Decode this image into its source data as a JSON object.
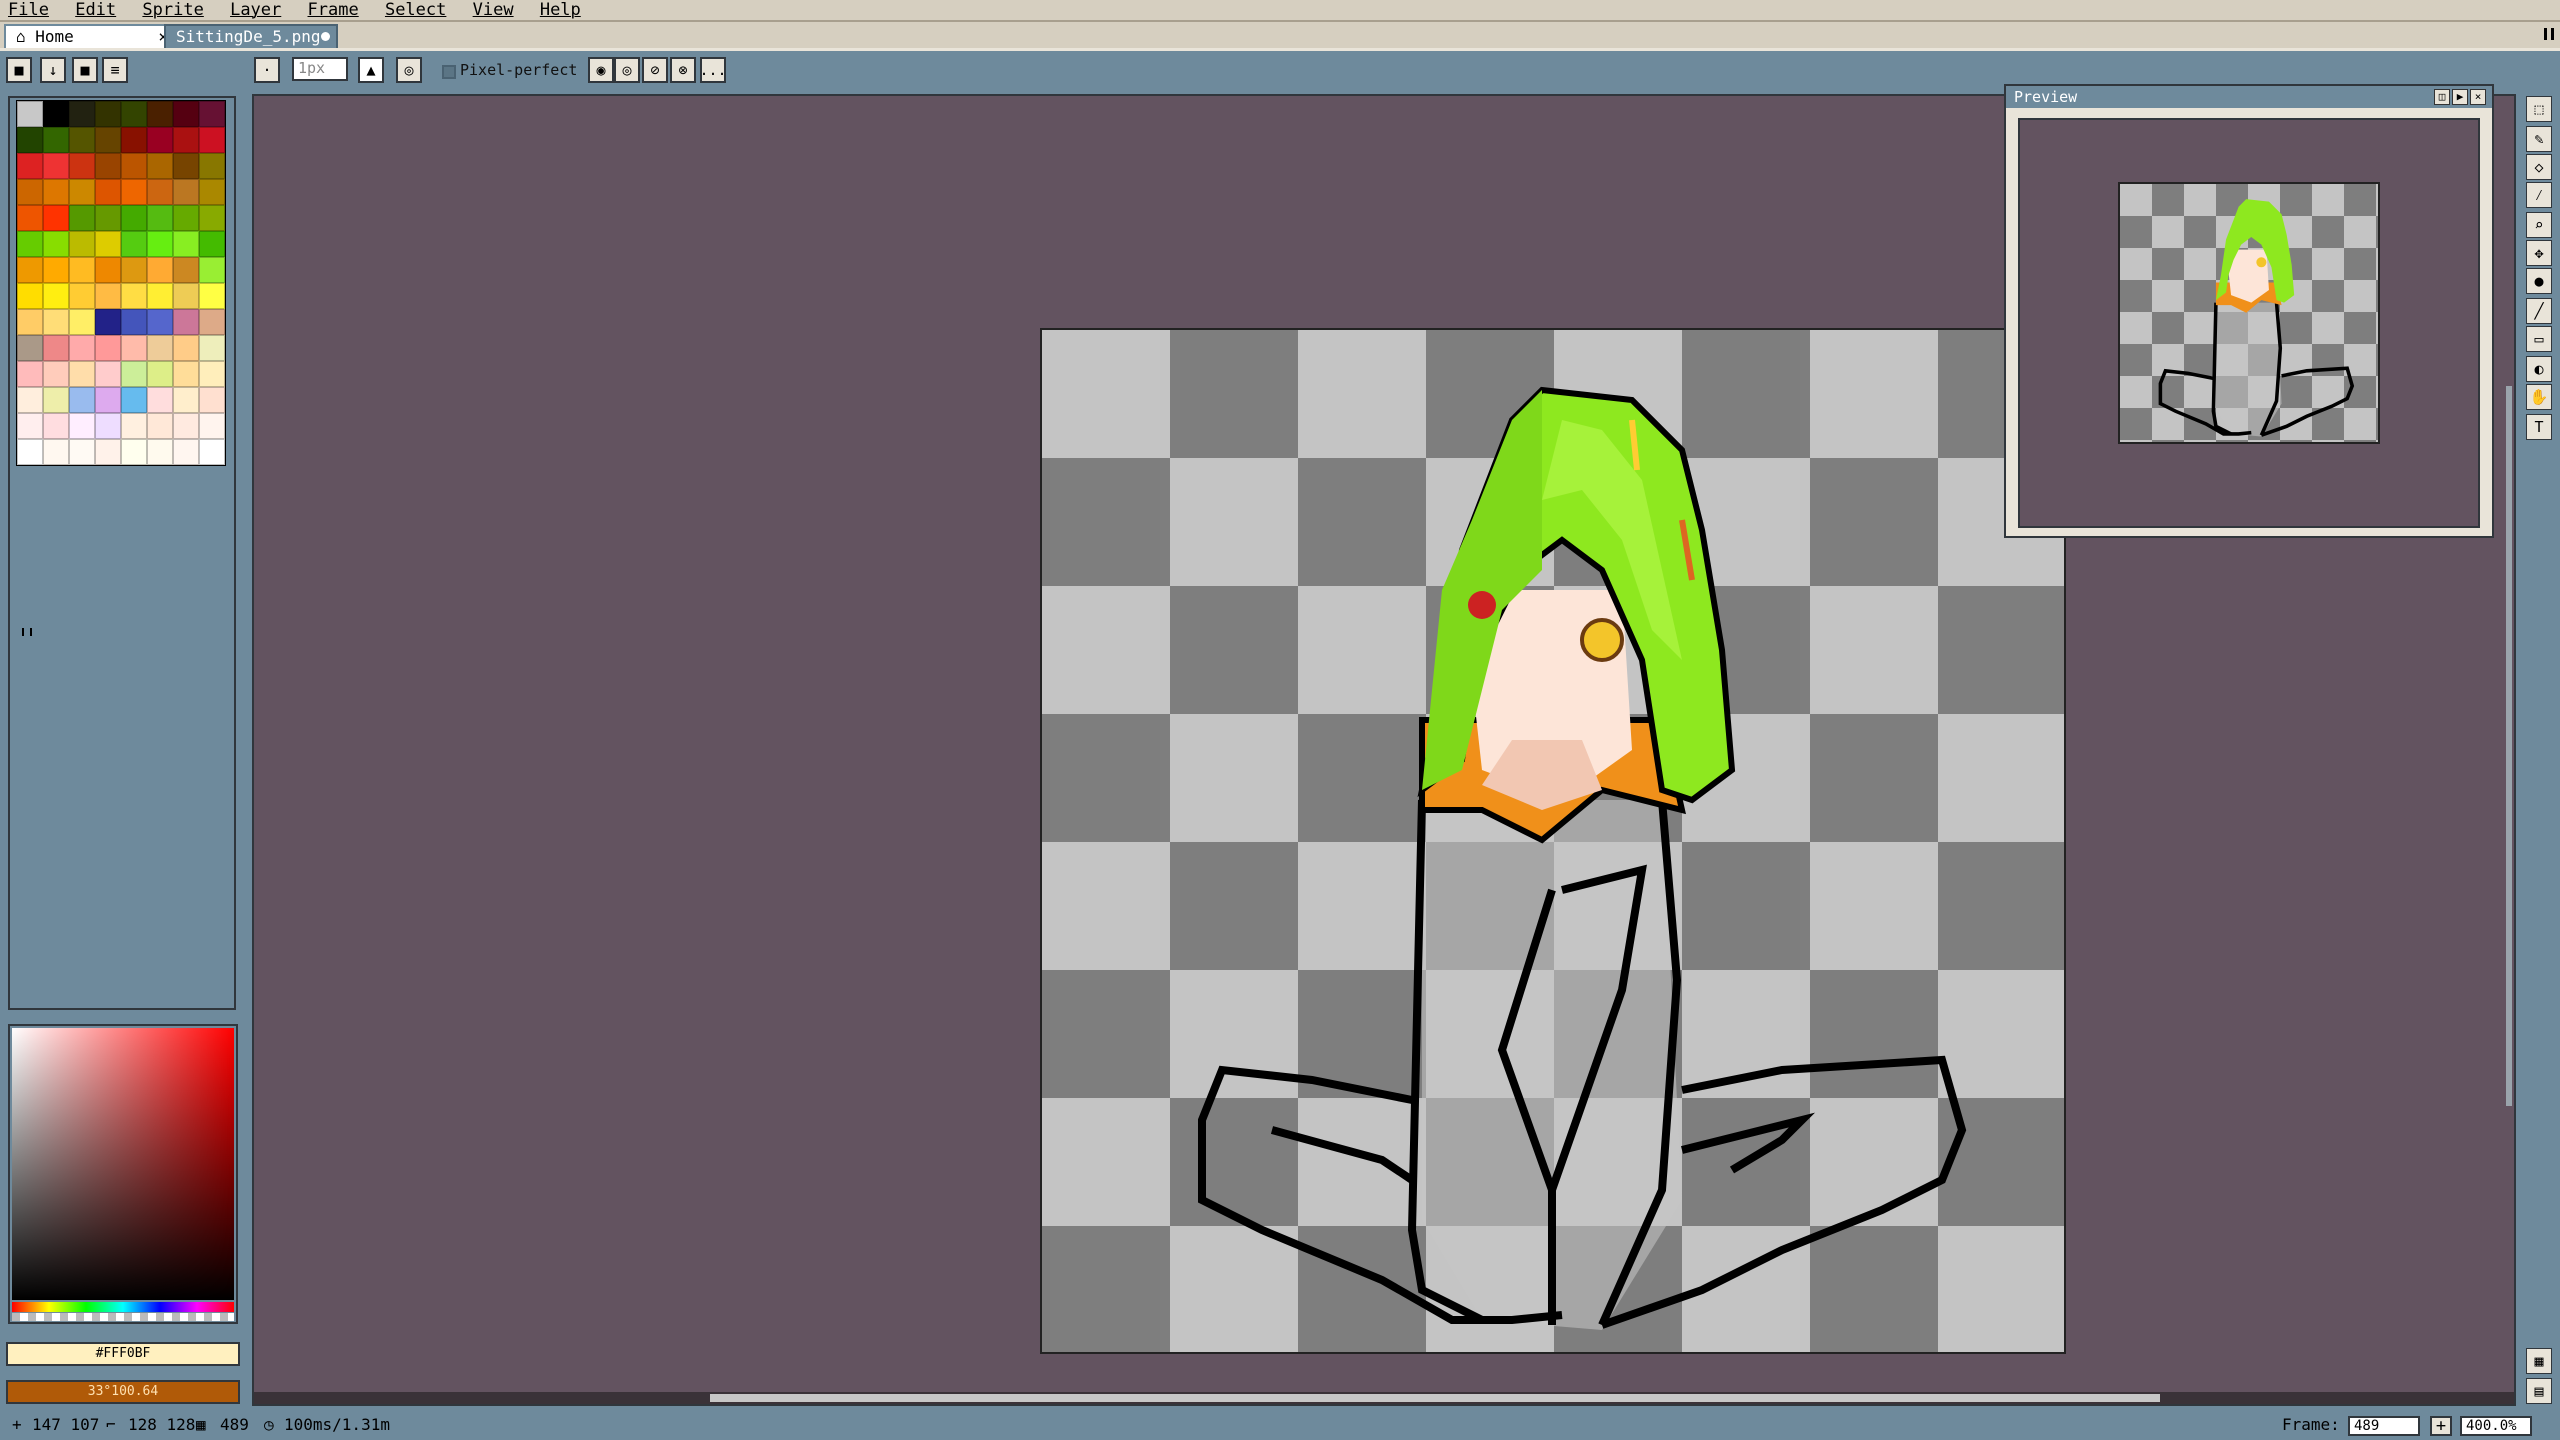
{
  "menu": [
    "File",
    "Edit",
    "Sprite",
    "Layer",
    "Frame",
    "Select",
    "View",
    "Help"
  ],
  "tabs": [
    {
      "label": "Home",
      "close": "×"
    },
    {
      "label": "SittingDe_5.png"
    }
  ],
  "toolbar": {
    "brush_size": "1px",
    "pixel_perfect_label": "Pixel-perfect",
    "more": "..."
  },
  "palette_colors": [
    "#c8c8c8",
    "#000000",
    "#222211",
    "#333300",
    "#334400",
    "#4a2000",
    "#550011",
    "#661133",
    "#224400",
    "#336600",
    "#555500",
    "#664400",
    "#881100",
    "#990022",
    "#aa1111",
    "#cc1122",
    "#dd2222",
    "#ee3333",
    "#cc3311",
    "#994400",
    "#bb5500",
    "#aa6600",
    "#774400",
    "#887700",
    "#cc6600",
    "#dd7700",
    "#cc8800",
    "#dd5500",
    "#ee6600",
    "#cc6611",
    "#bb7722",
    "#aa8800",
    "#ee5500",
    "#ff3300",
    "#559900",
    "#669900",
    "#44aa00",
    "#55bb11",
    "#66aa00",
    "#88aa00",
    "#66cc00",
    "#88dd00",
    "#bbbb00",
    "#ddcc00",
    "#55cc11",
    "#66ee11",
    "#88ee22",
    "#44bb00",
    "#ee9900",
    "#ffaa00",
    "#ffbb22",
    "#ee8800",
    "#dd9911",
    "#ffaa33",
    "#cc8822",
    "#99ee33",
    "#ffdd00",
    "#ffee11",
    "#ffcc33",
    "#ffbb44",
    "#ffdd44",
    "#ffee33",
    "#eecc55",
    "#ffff44",
    "#ffcc66",
    "#ffdd77",
    "#ffee66",
    "#222288",
    "#4455bb",
    "#5566cc",
    "#cc7799",
    "#ddaa88",
    "#aa9988",
    "#ee8888",
    "#ffaaaa",
    "#ff9999",
    "#ffbbaa",
    "#eecc99",
    "#ffcc88",
    "#eeeebb",
    "#ffbbbb",
    "#ffccbb",
    "#ffddaa",
    "#ffcccc",
    "#ccee99",
    "#ddee88",
    "#ffdd99",
    "#ffeebb",
    "#ffeedd",
    "#eeeeaa",
    "#99bbee",
    "#ddaaee",
    "#66bbee",
    "#ffdddd",
    "#ffeecc",
    "#ffe0d0",
    "#ffeeee",
    "#ffdde0",
    "#ffeeff",
    "#eeddff",
    "#fff0e0",
    "#ffe8d8",
    "#ffeae0",
    "#fff4ee",
    "#ffffff",
    "#fff8f0",
    "#fffaf4",
    "#fff2ea",
    "#ffffee",
    "#fffaee",
    "#fff6f0",
    "#ffffff"
  ],
  "fg_color": {
    "label": "#FFF0BF"
  },
  "bg_color": {
    "label": "33°100.64"
  },
  "preview": {
    "title": "Preview"
  },
  "status": {
    "cursor": "147 107",
    "size": "128 128",
    "frame_count": "489",
    "duration": "100ms/1.31m",
    "frame_label": "Frame:",
    "frame_value": "489",
    "zoom": "400.0%"
  },
  "icons": {
    "lock": "lock-icon",
    "down": "down-arrow-icon",
    "stop": "stop-icon",
    "list": "list-icon",
    "marquee": "marquee-icon",
    "pencil": "pencil-icon",
    "eraser": "eraser-icon",
    "eyedropper": "eyedropper-icon",
    "zoom": "zoom-icon",
    "move": "move-icon",
    "fill": "fill-icon",
    "line": "line-icon",
    "rect": "rectangle-icon",
    "blur": "blur-icon",
    "smudge": "smudge-icon",
    "text": "text-icon"
  }
}
